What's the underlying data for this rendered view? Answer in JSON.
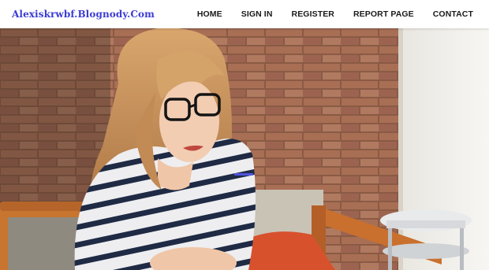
{
  "site": {
    "brand": "Alexiskrwbf.Blognody.Com"
  },
  "nav": {
    "items": [
      {
        "label": "HOME"
      },
      {
        "label": "SIGN IN"
      },
      {
        "label": "REGISTER"
      },
      {
        "label": "REPORT PAGE"
      },
      {
        "label": "CONTACT"
      }
    ]
  },
  "colors": {
    "brand": "#3b3bd6",
    "nav_text": "#1a1a1a",
    "accent": "#4f55e0"
  },
  "hero": {
    "icon": "hero-photo-woman-with-glasses"
  }
}
